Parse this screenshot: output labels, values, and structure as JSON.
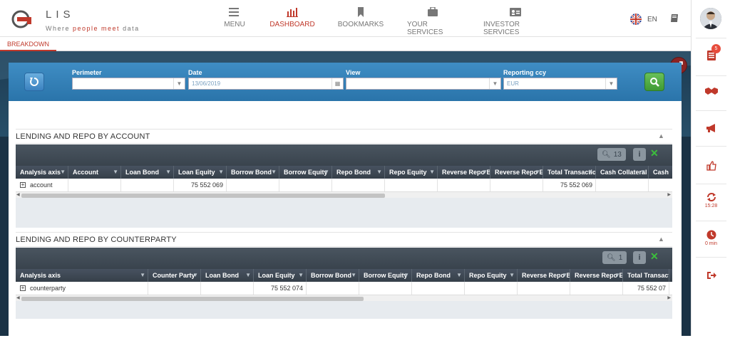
{
  "brand": {
    "title": "LIS",
    "tagline_a": "Where ",
    "tagline_b": "people meet",
    "tagline_c": " data",
    "accent": "#c0392b"
  },
  "nav": [
    {
      "label": "MENU",
      "icon": "hamburger-icon",
      "active": false
    },
    {
      "label": "DASHBOARD",
      "icon": "bar-chart-icon",
      "active": true
    },
    {
      "label": "BOOKMARKS",
      "icon": "bookmark-icon",
      "active": false
    },
    {
      "label": "YOUR SERVICES",
      "icon": "briefcase-icon",
      "active": false
    },
    {
      "label": "INVESTOR SERVICES",
      "icon": "id-card-icon",
      "active": false
    }
  ],
  "lang": {
    "code": "EN"
  },
  "rightbar": {
    "notifications_count": "5",
    "refresh_time": "15:28",
    "timer": "0 min"
  },
  "tab": {
    "label": "BREAKDOWN"
  },
  "filters": {
    "perimeter": {
      "label": "Perimeter",
      "value": ""
    },
    "date": {
      "label": "Date",
      "value": "13/06/2019"
    },
    "view": {
      "label": "View",
      "value": ""
    },
    "ccy": {
      "label": "Reporting ccy",
      "value": "EUR"
    }
  },
  "account_grid": {
    "title": "LENDING AND REPO BY ACCOUNT",
    "count": "13",
    "columns": [
      "Analysis axis",
      "Account",
      "Loan Bond",
      "Loan Equity",
      "Borrow Bond",
      "Borrow Equity",
      "Repo Bond",
      "Repo Equity",
      "Reverse Repo Bond",
      "Reverse Repo Equity",
      "Total Transactions",
      "Cash Collateral",
      "Cash"
    ],
    "row": {
      "axis": "account",
      "loan_equity": "75 552 069",
      "total": "75 552 069"
    }
  },
  "counterparty_grid": {
    "title": "LENDING AND REPO BY COUNTERPARTY",
    "count": "1",
    "columns": [
      "Analysis axis",
      "Counter Party",
      "Loan Bond",
      "Loan Equity",
      "Borrow Bond",
      "Borrow Equity",
      "Repo Bond",
      "Repo Equity",
      "Reverse Repo Bond",
      "Reverse Repo Equity",
      "Total Transactions"
    ],
    "row": {
      "axis": "counterparty",
      "loan_equity": "75 552 074",
      "total": "75 552 07"
    }
  }
}
